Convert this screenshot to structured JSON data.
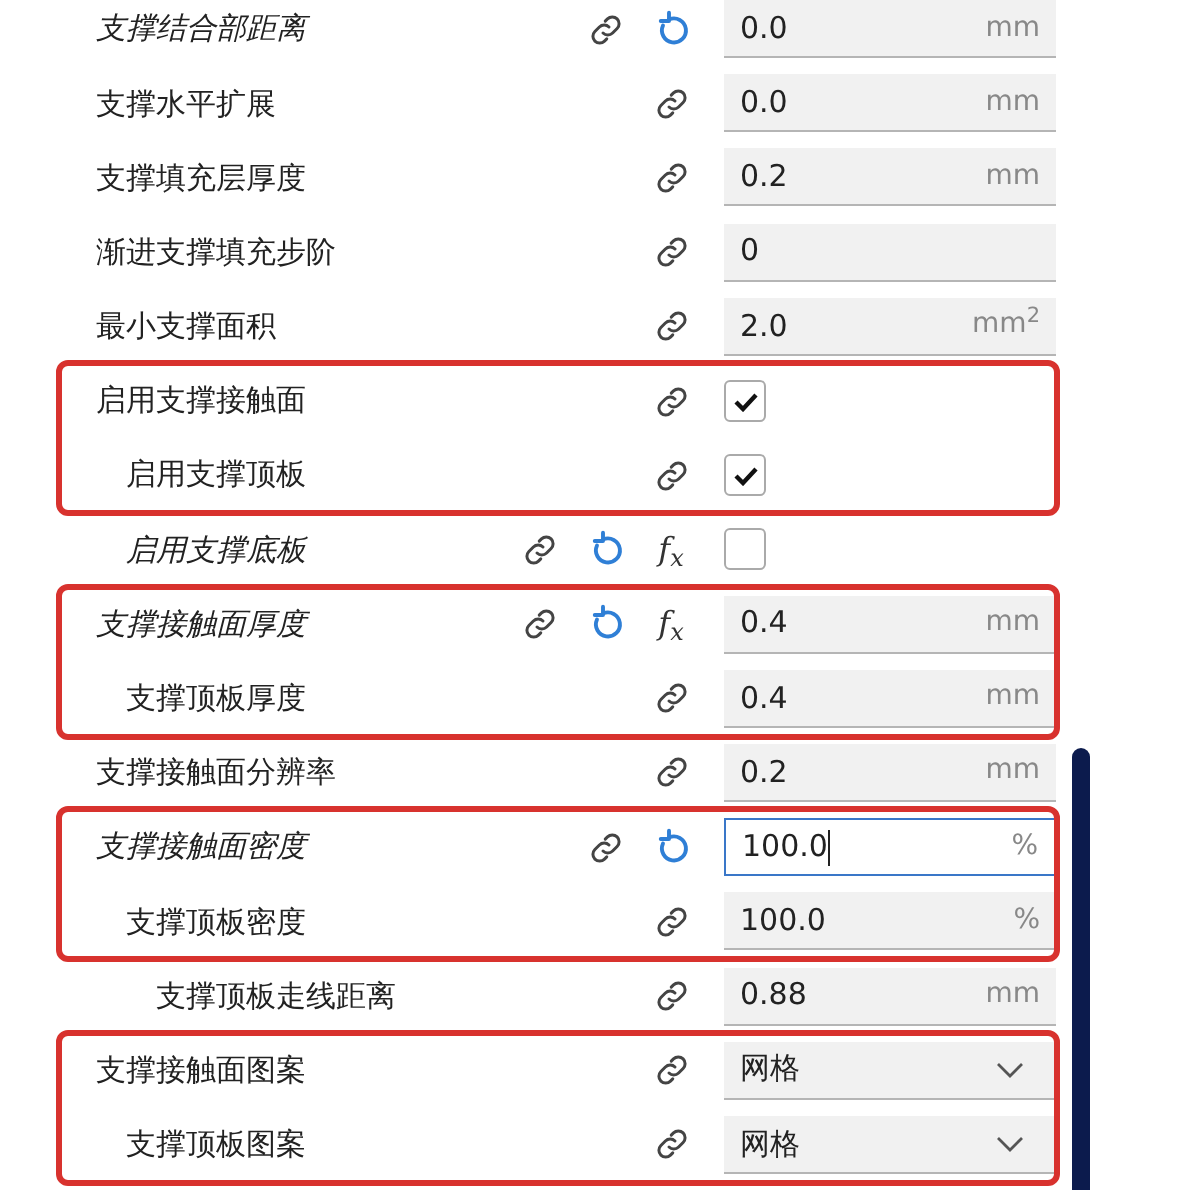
{
  "settings": [
    {
      "label": "支撑结合部距离",
      "kind": "number",
      "value": "0.0",
      "unit": "mm",
      "modified": true,
      "highlighted": false
    },
    {
      "label": "支撑水平扩展",
      "kind": "number",
      "value": "0.0",
      "unit": "mm",
      "modified": false,
      "highlighted": false
    },
    {
      "label": "支撑填充层厚度",
      "kind": "number",
      "value": "0.2",
      "unit": "mm",
      "modified": false,
      "highlighted": false
    },
    {
      "label": "渐进支撑填充步阶",
      "kind": "number",
      "value": "0",
      "modified": false,
      "highlighted": false
    },
    {
      "label": "最小支撑面积",
      "kind": "number",
      "value": "2.0",
      "unit": "mm$^{2}$",
      "modified": false,
      "highlighted": false
    },
    {
      "label": "启用支撑接触面",
      "kind": "checkbox",
      "checked": true,
      "modified": false,
      "highlighted": true,
      "children": [
        {
          "label": "启用支撑顶板",
          "kind": "checkbox",
          "checked": true,
          "modified": false,
          "highlighted": true
        },
        {
          "label": "启用支撑底板",
          "kind": "checkbox",
          "checked": false,
          "modified": true,
          "formula": "f$_{x}$",
          "highlighted": false
        }
      ]
    },
    {
      "label": "支撑接触面厚度",
      "kind": "number",
      "value": "0.4",
      "unit": "mm",
      "modified": true,
      "formula": "f$_{x}$",
      "highlighted": true,
      "children": [
        {
          "label": "支撑顶板厚度",
          "kind": "number",
          "value": "0.4",
          "unit": "mm",
          "modified": false,
          "highlighted": true
        }
      ]
    },
    {
      "label": "支撑接触面分辨率",
      "kind": "number",
      "value": "0.2",
      "unit": "mm",
      "modified": false,
      "highlighted": false
    },
    {
      "label": "支撑接触面密度",
      "kind": "number",
      "value": "100.0",
      "unit": "%",
      "modified": true,
      "focused": true,
      "highlighted": true,
      "children": [
        {
          "label": "支撑顶板密度",
          "kind": "number",
          "value": "100.0",
          "unit": "%",
          "modified": false,
          "highlighted": true,
          "children": [
            {
              "label": "支撑顶板走线距离",
              "kind": "number",
              "value": "0.88",
              "unit": "mm",
              "modified": false,
              "highlighted": false
            }
          ]
        }
      ]
    },
    {
      "label": "支撑接触面图案",
      "kind": "dropdown",
      "value": "网格",
      "modified": false,
      "highlighted": true,
      "children": [
        {
          "label": "支撑顶板图案",
          "kind": "dropdown",
          "value": "网格",
          "modified": false,
          "highlighted": true
        }
      ]
    }
  ]
}
